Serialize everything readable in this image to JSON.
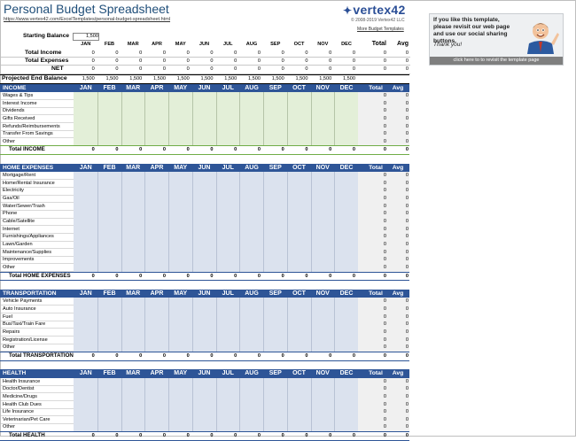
{
  "header": {
    "title": "Personal Budget Spreadsheet",
    "url": "https://www.vertex42.com/ExcelTemplates/personal-budget-spreadsheet.html",
    "logo": "vertex42",
    "logo_mark": "✦",
    "copyright": "© 2008-2019 Vertex42 LLC",
    "more_link": "More Budget Templates"
  },
  "promo": {
    "text": "If you like this template, please revisit our web page and use our social sharing buttons.",
    "thanks": "Thank you!",
    "button": "click here to to revisit the template page"
  },
  "months": [
    "JAN",
    "FEB",
    "MAR",
    "APR",
    "MAY",
    "JUN",
    "JUL",
    "AUG",
    "SEP",
    "OCT",
    "NOV",
    "DEC"
  ],
  "total_label": "Total",
  "avg_label": "Avg",
  "summary": {
    "starting_balance_label": "Starting Balance",
    "starting_balance": "1,500",
    "rows": [
      {
        "label": "Total Income",
        "values": [
          "0",
          "0",
          "0",
          "0",
          "0",
          "0",
          "0",
          "0",
          "0",
          "0",
          "0",
          "0"
        ],
        "total": "0",
        "avg": "0"
      },
      {
        "label": "Total Expenses",
        "values": [
          "0",
          "0",
          "0",
          "0",
          "0",
          "0",
          "0",
          "0",
          "0",
          "0",
          "0",
          "0"
        ],
        "total": "0",
        "avg": "0"
      },
      {
        "label": "NET",
        "values": [
          "0",
          "0",
          "0",
          "0",
          "0",
          "0",
          "0",
          "0",
          "0",
          "0",
          "0",
          "0"
        ],
        "total": "0",
        "avg": "0"
      }
    ],
    "projected_label": "Projected End Balance",
    "projected": [
      "1,500",
      "1,500",
      "1,500",
      "1,500",
      "1,500",
      "1,500",
      "1,500",
      "1,500",
      "1,500",
      "1,500",
      "1,500",
      "1,500"
    ]
  },
  "sections": [
    {
      "name": "INCOME",
      "color": "green",
      "items": [
        "Wages & Tips",
        "Interest Income",
        "Dividends",
        "Gifts Received",
        "Refunds/Reimbursements",
        "Transfer From Savings",
        "Other"
      ],
      "total_label": "Total INCOME"
    },
    {
      "name": "HOME EXPENSES",
      "color": "blue",
      "items": [
        "Mortgage/Rent",
        "Home/Rental Insurance",
        "Electricity",
        "Gas/Oil",
        "Water/Sewer/Trash",
        "Phone",
        "Cable/Satellite",
        "Internet",
        "Furnishings/Appliances",
        "Lawn/Garden",
        "Maintenance/Supplies",
        "Improvements",
        "Other"
      ],
      "total_label": "Total HOME EXPENSES"
    },
    {
      "name": "TRANSPORTATION",
      "color": "blue",
      "items": [
        "Vehicle Payments",
        "Auto Insurance",
        "Fuel",
        "Bus/Taxi/Train Fare",
        "Repairs",
        "Registration/License",
        "Other"
      ],
      "total_label": "Total TRANSPORTATION"
    },
    {
      "name": "HEALTH",
      "color": "blue",
      "items": [
        "Health Insurance",
        "Doctor/Dentist",
        "Medicine/Drugs",
        "Health Club Dues",
        "Life Insurance",
        "Veterinarian/Pet Care",
        "Other"
      ],
      "total_label": "Total HEALTH"
    }
  ],
  "zero": "0",
  "colors": {
    "header_blue": "#2e5597",
    "income_fill": "#e3efd8",
    "expense_fill": "#dbe2ee",
    "title": "#1f4e79"
  }
}
